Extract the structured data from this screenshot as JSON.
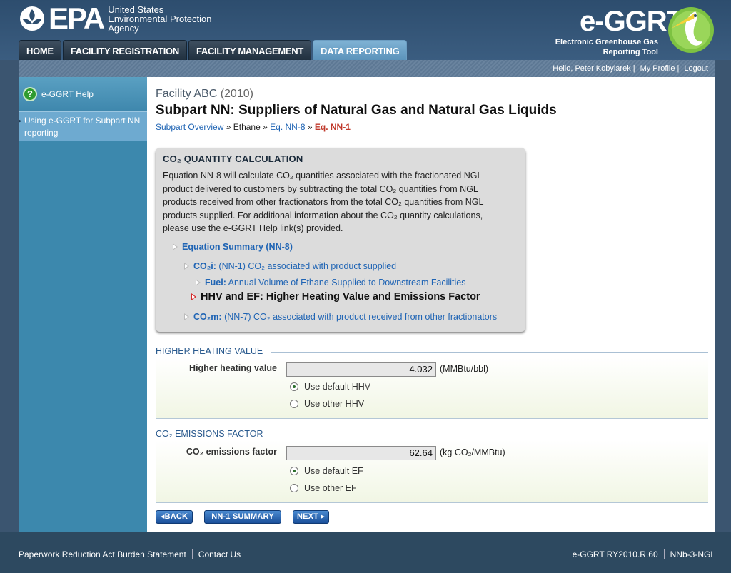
{
  "header": {
    "agency_line1": "United States",
    "agency_line2": "Environmental Protection",
    "agency_line3": "Agency",
    "epa_word": "EPA",
    "app_logo": "e-GGRT",
    "app_sub1": "Electronic Greenhouse Gas",
    "app_sub2": "Reporting Tool"
  },
  "tabs": [
    {
      "label": "HOME"
    },
    {
      "label": "FACILITY REGISTRATION"
    },
    {
      "label": "FACILITY MANAGEMENT"
    },
    {
      "label": "DATA REPORTING"
    }
  ],
  "userbar": {
    "greeting": "Hello, Peter Kobylarek",
    "profile": "My Profile",
    "logout": "Logout"
  },
  "sidebar": {
    "help": "e-GGRT Help",
    "link": "Using e-GGRT for Subpart NN reporting"
  },
  "main": {
    "facility": "Facility ABC",
    "year": "(2010)",
    "title": "Subpart NN: Suppliers of Natural Gas and Natural Gas Liquids",
    "crumbs": {
      "overview": "Subpart Overview",
      "ethane": "Ethane",
      "nn8": "Eq. NN-8",
      "nn1": "Eq. NN-1"
    }
  },
  "calc": {
    "title": "CO₂ QUANTITY CALCULATION",
    "description": "Equation NN-8 will calculate CO₂ quantities associated with the fractionated NGL product delivered to customers by subtracting the total CO₂ quantities from NGL products received from other fractionators from the total CO₂ quantities from NGL products supplied. For additional information about the CO₂ quantity calculations, please use the e-GGRT Help link(s) provided.",
    "eq_summary": "Equation Summary (NN-8)",
    "co2i_bold": "CO₂i:",
    "co2i_text": " (NN-1) CO₂ associated with product supplied",
    "fuel_bold": "Fuel:",
    "fuel_text": " Annual Volume of Ethane Supplied to Downstream Facilities",
    "current": "HHV and EF: Higher Heating Value and Emissions Factor",
    "co2m_bold": "CO₂m:",
    "co2m_text": " (NN-7) CO₂ associated with product received from other fractionators"
  },
  "hhv": {
    "section": "HIGHER HEATING VALUE",
    "label": "Higher heating value",
    "value": "4.032",
    "unit": "(MMBtu/bbl)",
    "opt_default": "Use default HHV",
    "opt_other": "Use other HHV"
  },
  "ef": {
    "section": "CO₂ EMISSIONS FACTOR",
    "label": "CO₂ emissions factor",
    "value": "62.64",
    "unit": "(kg CO₂/MMBtu)",
    "opt_default": "Use default EF",
    "opt_other": "Use other EF"
  },
  "buttons": {
    "back": "◂BACK",
    "summary": "NN-1 SUMMARY",
    "next": "NEXT ▸"
  },
  "footer": {
    "paperwork": "Paperwork Reduction Act Burden Statement",
    "contact": "Contact Us",
    "version": "e-GGRT RY2010.R.60",
    "page_id": "NNb-3-NGL"
  }
}
